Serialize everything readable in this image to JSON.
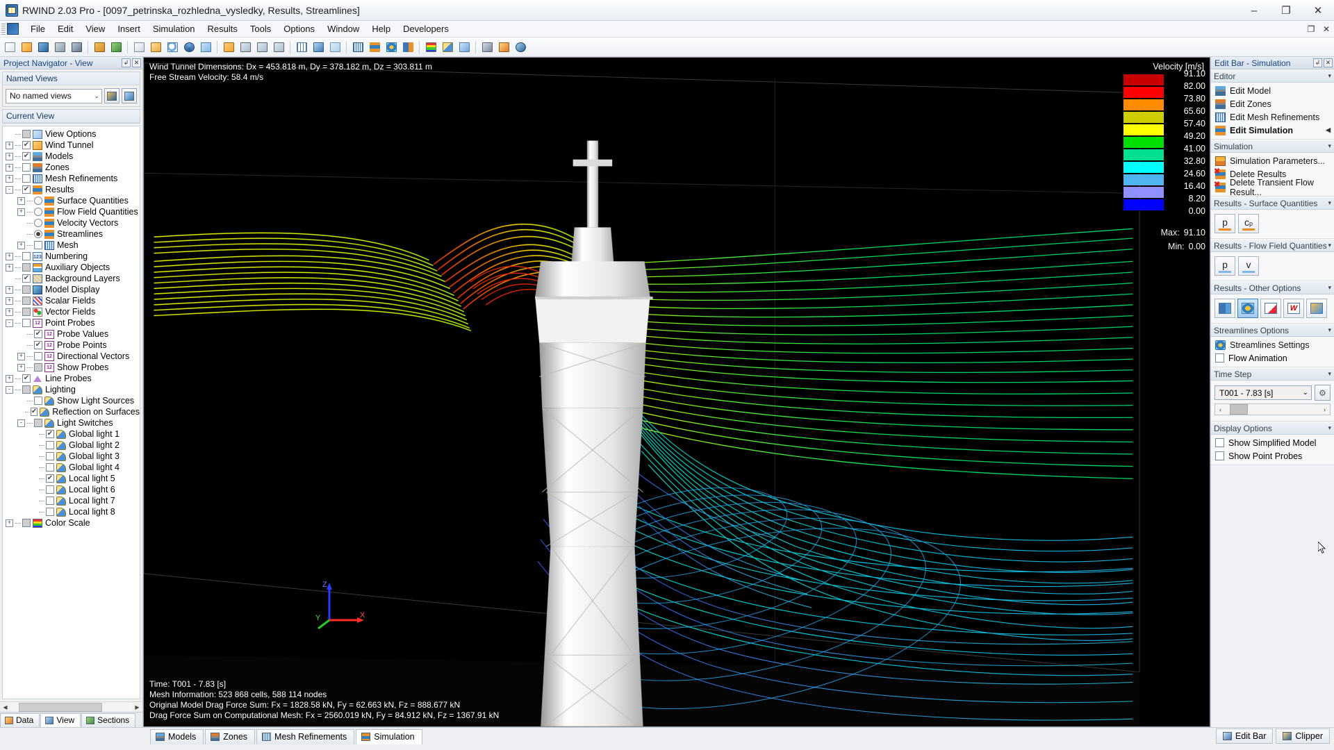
{
  "window": {
    "title": "RWIND 2.03 Pro - [0097_petrinska_rozhledna_vysledky, Results, Streamlines]",
    "app_icon": "rwind-icon",
    "minimize": "–",
    "maximize": "❐",
    "close": "✕"
  },
  "menubar": {
    "items": [
      "File",
      "Edit",
      "View",
      "Insert",
      "Simulation",
      "Results",
      "Tools",
      "Options",
      "Window",
      "Help",
      "Developers"
    ],
    "doc_restore": "❐",
    "doc_close": "✕"
  },
  "left_panel": {
    "caption": "Project Navigator - View",
    "pin": "↲",
    "close": "✕",
    "named_views": {
      "group_title": "Named Views",
      "selected": "No named views",
      "chevron": "⌄"
    },
    "current_view": {
      "group_title": "Current View"
    },
    "tree": [
      {
        "depth": 0,
        "expander": "",
        "check": "sq-gray",
        "icon": "view-options-icon",
        "label": "View Options"
      },
      {
        "depth": 0,
        "expander": "+",
        "check": "checked",
        "icon": "wind-tunnel-icon",
        "label": "Wind Tunnel"
      },
      {
        "depth": 0,
        "expander": "+",
        "check": "checked",
        "icon": "models-icon",
        "label": "Models"
      },
      {
        "depth": 0,
        "expander": "+",
        "check": "empty",
        "icon": "zones-icon",
        "label": "Zones"
      },
      {
        "depth": 0,
        "expander": "+",
        "check": "empty",
        "icon": "mesh-refinements-icon",
        "label": "Mesh Refinements"
      },
      {
        "depth": 0,
        "expander": "-",
        "check": "checked",
        "icon": "results-icon",
        "label": "Results"
      },
      {
        "depth": 1,
        "expander": "+",
        "check": "radio",
        "icon": "surface-quantities-icon",
        "label": "Surface Quantities"
      },
      {
        "depth": 1,
        "expander": "+",
        "check": "radio",
        "icon": "flow-field-quantities-icon",
        "label": "Flow Field Quantities"
      },
      {
        "depth": 1,
        "expander": "",
        "check": "radio",
        "icon": "velocity-vectors-icon",
        "label": "Velocity Vectors"
      },
      {
        "depth": 1,
        "expander": "",
        "check": "radio-selected",
        "icon": "streamlines-icon",
        "label": "Streamlines"
      },
      {
        "depth": 1,
        "expander": "+",
        "check": "empty",
        "icon": "mesh-icon",
        "label": "Mesh"
      },
      {
        "depth": 0,
        "expander": "+",
        "check": "empty",
        "icon": "numbering-icon",
        "label": "Numbering"
      },
      {
        "depth": 0,
        "expander": "+",
        "check": "sq-gray",
        "icon": "auxiliary-objects-icon",
        "label": "Auxiliary Objects"
      },
      {
        "depth": 0,
        "expander": "",
        "check": "checked",
        "icon": "background-layers-icon",
        "label": "Background Layers"
      },
      {
        "depth": 0,
        "expander": "+",
        "check": "sq-gray",
        "icon": "model-display-icon",
        "label": "Model Display"
      },
      {
        "depth": 0,
        "expander": "+",
        "check": "sq-gray",
        "icon": "scalar-fields-icon",
        "label": "Scalar Fields"
      },
      {
        "depth": 0,
        "expander": "+",
        "check": "sq-gray",
        "icon": "vector-fields-icon",
        "label": "Vector Fields"
      },
      {
        "depth": 0,
        "expander": "-",
        "check": "empty",
        "icon": "point-probes-icon",
        "label": "Point Probes"
      },
      {
        "depth": 1,
        "expander": "",
        "check": "checked",
        "icon": "probe-values-icon",
        "label": "Probe Values"
      },
      {
        "depth": 1,
        "expander": "",
        "check": "checked",
        "icon": "probe-points-icon",
        "label": "Probe Points"
      },
      {
        "depth": 1,
        "expander": "+",
        "check": "empty",
        "icon": "directional-vectors-icon",
        "label": "Directional Vectors"
      },
      {
        "depth": 1,
        "expander": "+",
        "check": "sq-gray",
        "icon": "show-probes-icon",
        "label": "Show Probes"
      },
      {
        "depth": 0,
        "expander": "+",
        "check": "checked",
        "icon": "line-probes-icon",
        "label": "Line Probes"
      },
      {
        "depth": 0,
        "expander": "-",
        "check": "sq-gray",
        "icon": "lighting-icon",
        "label": "Lighting"
      },
      {
        "depth": 1,
        "expander": "",
        "check": "empty",
        "icon": "show-light-sources-icon",
        "label": "Show Light Sources"
      },
      {
        "depth": 1,
        "expander": "",
        "check": "checked",
        "icon": "reflection-on-surfaces-icon",
        "label": "Reflection on Surfaces"
      },
      {
        "depth": 1,
        "expander": "-",
        "check": "sq-gray",
        "icon": "light-switches-icon",
        "label": "Light Switches"
      },
      {
        "depth": 2,
        "expander": "",
        "check": "checked",
        "icon": "light-icon",
        "label": "Global light 1"
      },
      {
        "depth": 2,
        "expander": "",
        "check": "empty",
        "icon": "light-icon",
        "label": "Global light 2"
      },
      {
        "depth": 2,
        "expander": "",
        "check": "empty",
        "icon": "light-icon",
        "label": "Global light 3"
      },
      {
        "depth": 2,
        "expander": "",
        "check": "empty",
        "icon": "light-icon",
        "label": "Global light 4"
      },
      {
        "depth": 2,
        "expander": "",
        "check": "checked",
        "icon": "light-icon",
        "label": "Local light 5"
      },
      {
        "depth": 2,
        "expander": "",
        "check": "empty",
        "icon": "light-icon",
        "label": "Local light 6"
      },
      {
        "depth": 2,
        "expander": "",
        "check": "empty",
        "icon": "light-icon",
        "label": "Local light 7"
      },
      {
        "depth": 2,
        "expander": "",
        "check": "empty",
        "icon": "light-icon",
        "label": "Local light 8"
      },
      {
        "depth": 0,
        "expander": "+",
        "check": "sq-gray",
        "icon": "color-scale-icon",
        "label": "Color Scale"
      }
    ],
    "scroll": {
      "left_arrow": "◀",
      "right_arrow": "▶"
    },
    "tabs": [
      {
        "label": "Data",
        "icon": "data-icon",
        "active": false
      },
      {
        "label": "View",
        "icon": "view-icon",
        "active": true
      },
      {
        "label": "Sections",
        "icon": "sections-icon",
        "active": false
      }
    ]
  },
  "viewport": {
    "top_info": [
      "Wind Tunnel Dimensions: Dx = 453.818 m, Dy = 378.182 m, Dz = 303.811 m",
      "Free Stream Velocity: 58.4 m/s"
    ],
    "bottom_info": [
      "Time: T001 - 7.83 [s]",
      "Mesh Information: 523 868 cells, 588 114 nodes",
      "Original Model Drag Force Sum: Fx = 1828.58 kN, Fy = 62.663 kN, Fz = 888.677 kN",
      "Drag Force Sum on Computational Mesh: Fx = 2560.019 kN, Fy = 84.912 kN, Fz = 1367.91 kN"
    ],
    "axes": {
      "x": "X",
      "y": "Y",
      "z": "Z"
    }
  },
  "legend": {
    "title": "Velocity [m/s]",
    "values": [
      "91.10",
      "82.00",
      "73.80",
      "65.60",
      "57.40",
      "49.20",
      "41.00",
      "32.80",
      "24.60",
      "16.40",
      "8.20",
      "0.00"
    ],
    "colors": [
      "#c80000",
      "#ff0000",
      "#ff8c00",
      "#cdcd00",
      "#ffff00",
      "#00e000",
      "#00e090",
      "#00ffff",
      "#50b4f0",
      "#9090ff",
      "#0000ff"
    ],
    "max_label": "Max:",
    "max_value": "91.10",
    "min_label": "Min:",
    "min_value": "0.00"
  },
  "right_panel": {
    "caption": "Edit Bar - Simulation",
    "pin": "↲",
    "close": "✕",
    "sections": [
      {
        "title": "Editor",
        "caret": "▾",
        "type": "list",
        "items": [
          {
            "label": "Edit Model",
            "icon": "edit-model-icon",
            "bold": false,
            "arrow": ""
          },
          {
            "label": "Edit Zones",
            "icon": "edit-zones-icon",
            "bold": false,
            "arrow": ""
          },
          {
            "label": "Edit Mesh Refinements",
            "icon": "edit-mesh-refinements-icon",
            "bold": false,
            "arrow": ""
          },
          {
            "label": "Edit Simulation",
            "icon": "edit-simulation-icon",
            "bold": true,
            "arrow": "◀"
          }
        ]
      },
      {
        "title": "Simulation",
        "caret": "▾",
        "type": "list",
        "items": [
          {
            "label": "Simulation Parameters...",
            "icon": "simulation-parameters-icon",
            "bold": false,
            "arrow": ""
          },
          {
            "label": "Delete Results",
            "icon": "delete-results-icon",
            "bold": false,
            "arrow": ""
          },
          {
            "label": "Delete Transient Flow Result...",
            "icon": "delete-transient-flow-results-icon",
            "bold": false,
            "arrow": ""
          }
        ]
      },
      {
        "title": "Results - Surface Quantities",
        "caret": "▾",
        "type": "quantity-buttons",
        "buttons": [
          {
            "label": "p",
            "sub": "",
            "underline": "orange",
            "name": "pressure-button",
            "selected": false
          },
          {
            "label": "c",
            "sub": "p",
            "underline": "orange",
            "name": "cp-button",
            "selected": false
          }
        ]
      },
      {
        "title": "Results - Flow Field Quantities",
        "caret": "▾",
        "type": "quantity-buttons",
        "buttons": [
          {
            "label": "p",
            "sub": "",
            "underline": "blue",
            "name": "flow-pressure-button",
            "selected": false
          },
          {
            "label": "v",
            "sub": "",
            "underline": "blue",
            "name": "flow-velocity-button",
            "selected": false
          }
        ]
      },
      {
        "title": "Results - Other Options",
        "caret": "▾",
        "type": "icon-buttons",
        "buttons": [
          {
            "name": "velocity-vectors-button",
            "selected": false
          },
          {
            "name": "streamlines-button",
            "selected": true
          },
          {
            "name": "result-diagram-button",
            "selected": false
          },
          {
            "name": "wind-profile-button",
            "selected": false
          },
          {
            "name": "result-values-button",
            "selected": false
          }
        ]
      },
      {
        "title": "Streamlines Options",
        "caret": "▾",
        "type": "mixed",
        "items": [
          {
            "kind": "action",
            "label": "Streamlines Settings",
            "icon": "streamlines-settings-icon"
          },
          {
            "kind": "checkbox",
            "label": "Flow Animation",
            "checked": false
          }
        ]
      },
      {
        "title": "Time Step",
        "caret": "▾",
        "type": "timestep",
        "selected": "T001 - 7.83 [s]",
        "chevron": "⌄",
        "gear": "⚙",
        "left_arrow": "‹",
        "right_arrow": "›"
      },
      {
        "title": "Display Options",
        "caret": "▾",
        "type": "checkboxes",
        "items": [
          {
            "label": "Show Simplified Model",
            "checked": false
          },
          {
            "label": "Show Point Probes",
            "checked": false
          }
        ]
      }
    ]
  },
  "bottom_bar": {
    "tabs": [
      {
        "label": "Models",
        "icon": "models-tab-icon",
        "active": false
      },
      {
        "label": "Zones",
        "icon": "zones-tab-icon",
        "active": false
      },
      {
        "label": "Mesh Refinements",
        "icon": "mesh-refinements-tab-icon",
        "active": false
      },
      {
        "label": "Simulation",
        "icon": "simulation-tab-icon",
        "active": true
      }
    ],
    "right_buttons": [
      {
        "label": "Edit Bar",
        "icon": "edit-bar-icon"
      },
      {
        "label": "Clipper",
        "icon": "clipper-icon"
      }
    ]
  },
  "chart_data": {
    "type": "heatmap",
    "title": "Velocity [m/s]",
    "legend_ticks": [
      91.1,
      82.0,
      73.8,
      65.6,
      57.4,
      49.2,
      41.0,
      32.8,
      24.6,
      16.4,
      8.2,
      0.0
    ],
    "band_colors": [
      "#c80000",
      "#ff0000",
      "#ff8c00",
      "#cdcd00",
      "#ffff00",
      "#00e000",
      "#00e090",
      "#00ffff",
      "#50b4f0",
      "#9090ff",
      "#0000ff"
    ],
    "max": 91.1,
    "min": 0.0,
    "free_stream_velocity": 58.4,
    "domain": {
      "Dx": 453.818,
      "Dy": 378.182,
      "Dz": 303.811
    },
    "mesh": {
      "cells": 523868,
      "nodes": 588114
    },
    "time_step": "T001 - 7.83 [s]"
  }
}
